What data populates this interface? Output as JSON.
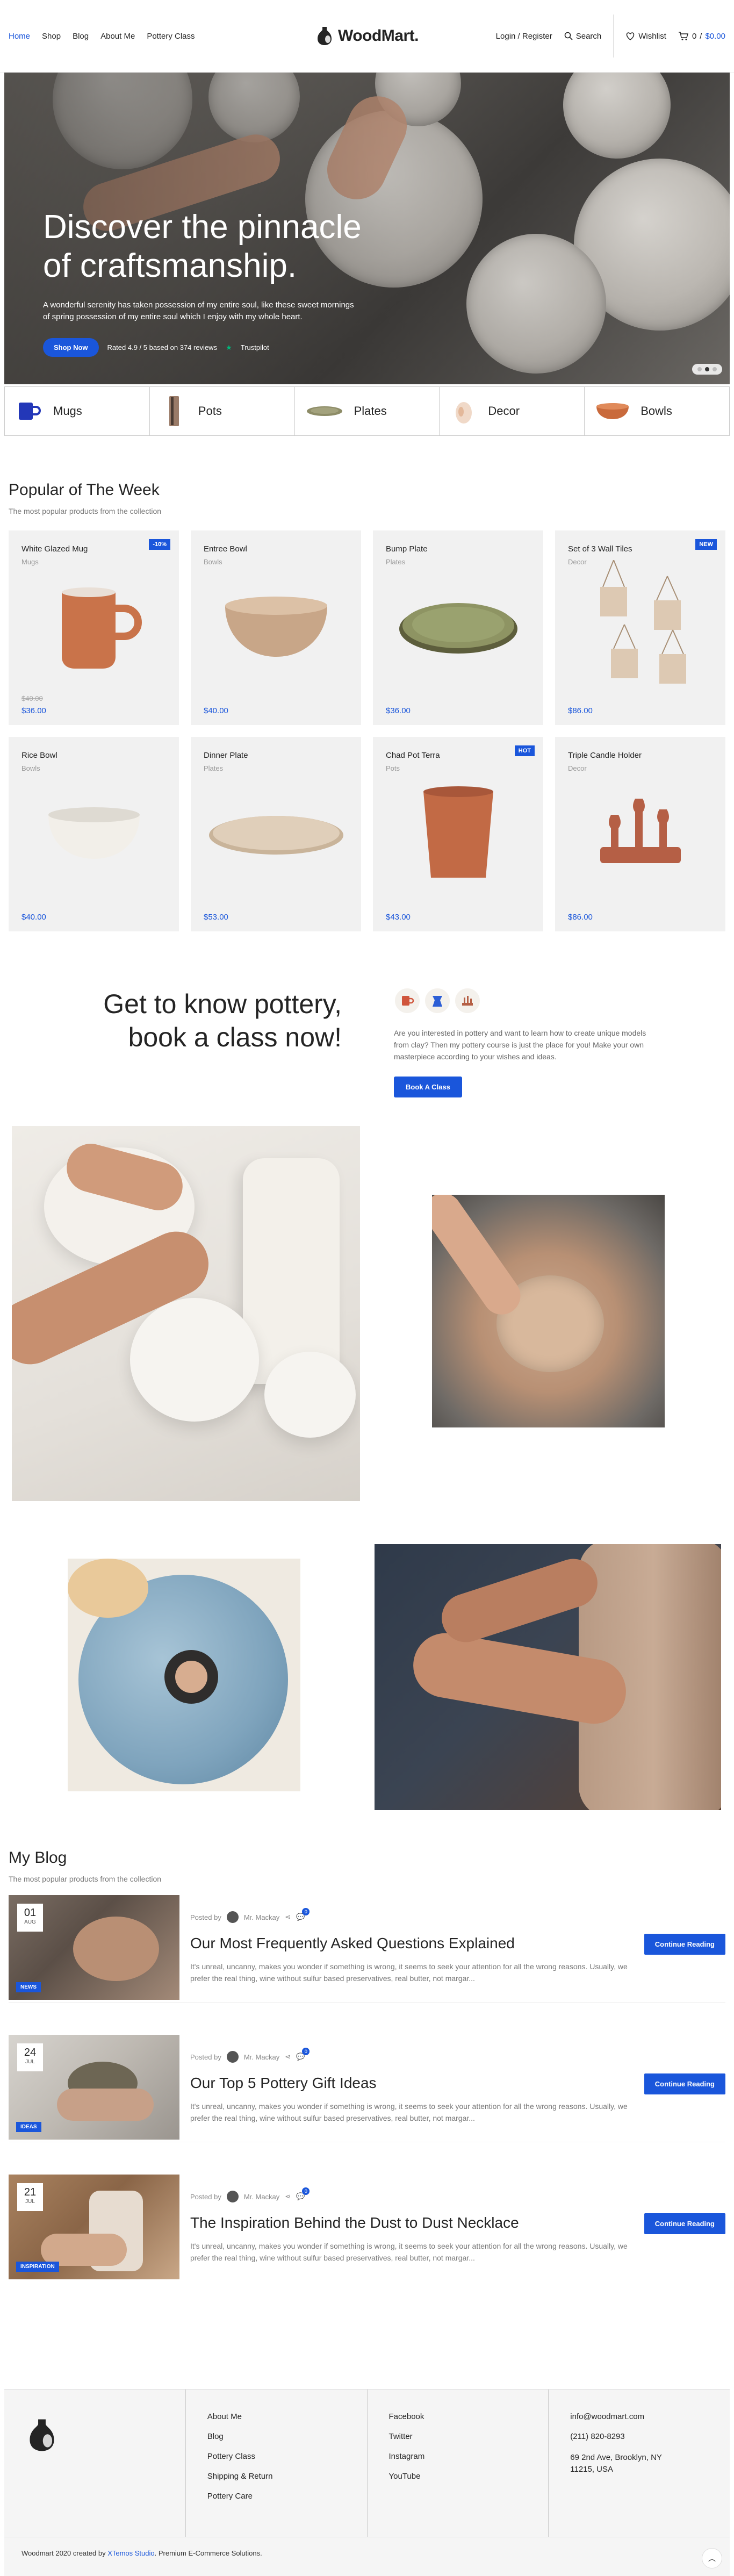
{
  "header": {
    "nav": [
      "Home",
      "Shop",
      "Blog",
      "About Me",
      "Pottery Class"
    ],
    "logo": "WoodMart.",
    "login": "Login / Register",
    "search": "Search",
    "wishlist": "Wishlist",
    "cart_count": "0",
    "cart_price": "$0.00",
    "accent": "#1a56db"
  },
  "hero": {
    "title_line1": "Discover the pinnacle",
    "title_line2": "of craftsmanship.",
    "text": "A wonderful serenity has taken possession of my entire soul, like these sweet mornings of spring possession of my entire soul which I enjoy with my whole heart.",
    "button": "Shop Now",
    "rating": "Rated 4.9 / 5 based on 374 reviews",
    "trustpilot": "Trustpilot"
  },
  "categories": [
    {
      "label": "Mugs",
      "icon": "mug-icon"
    },
    {
      "label": "Pots",
      "icon": "pot-icon"
    },
    {
      "label": "Plates",
      "icon": "plate-icon"
    },
    {
      "label": "Decor",
      "icon": "decor-icon"
    },
    {
      "label": "Bowls",
      "icon": "bowl-icon"
    }
  ],
  "popular": {
    "title": "Popular of The Week",
    "subtitle": "The most popular products from the collection",
    "products": [
      {
        "name": "White Glazed Mug",
        "category": "Mugs",
        "price": "$36.00",
        "old_price": "$40.00",
        "badge": "-10%"
      },
      {
        "name": "Entree Bowl",
        "category": "Bowls",
        "price": "$40.00"
      },
      {
        "name": "Bump Plate",
        "category": "Plates",
        "price": "$36.00"
      },
      {
        "name": "Set of 3 Wall Tiles",
        "category": "Decor",
        "price": "$86.00",
        "badge": "NEW"
      },
      {
        "name": "Rice Bowl",
        "category": "Bowls",
        "price": "$40.00"
      },
      {
        "name": "Dinner Plate",
        "category": "Plates",
        "price": "$53.00"
      },
      {
        "name": "Chad Pot Terra",
        "category": "Pots",
        "price": "$43.00",
        "badge": "HOT"
      },
      {
        "name": "Triple Candle Holder",
        "category": "Decor",
        "price": "$86.00"
      }
    ]
  },
  "klass": {
    "title_line1": "Get to know pottery,",
    "title_line2": "book a class now!",
    "text": "Are you interested in pottery and want to learn how to create unique models from clay? Then my pottery course is just the place for you! Make your own masterpiece according to your wishes and ideas.",
    "button": "Book A Class"
  },
  "blog": {
    "title": "My Blog",
    "subtitle": "The most popular products from the collection",
    "posted_by": "Posted by",
    "author": "Mr. Mackay",
    "read_more": "Continue Reading",
    "posts": [
      {
        "day": "01",
        "month": "AUG",
        "tag": "NEWS",
        "comments": "0",
        "title": "Our Most Frequently Asked Questions Explained",
        "excerpt": "It's unreal, uncanny, makes you wonder if something is wrong, it seems to seek your attention for all the wrong reasons. Usually, we prefer the real thing, wine without sulfur based preservatives, real butter, not margar..."
      },
      {
        "day": "24",
        "month": "JUL",
        "tag": "IDEAS",
        "comments": "0",
        "title": "Our Top 5 Pottery Gift Ideas",
        "excerpt": "It's unreal, uncanny, makes you wonder if something is wrong, it seems to seek your attention for all the wrong reasons. Usually, we prefer the real thing, wine without sulfur based preservatives, real butter, not margar..."
      },
      {
        "day": "21",
        "month": "JUL",
        "tag": "INSPIRATION",
        "comments": "0",
        "title": "The Inspiration Behind the Dust to Dust Necklace",
        "excerpt": "It's unreal, uncanny, makes you wonder if something is wrong, it seems to seek your attention for all the wrong reasons. Usually, we prefer the real thing, wine without sulfur based preservatives, real butter, not margar..."
      }
    ]
  },
  "footer": {
    "links1": [
      "About Me",
      "Blog",
      "Pottery Class",
      "Shipping & Return",
      "Pottery Care"
    ],
    "links2": [
      "Facebook",
      "Twitter",
      "Instagram",
      "YouTube"
    ],
    "email": "info@woodmart.com",
    "phone": "(211) 820-8293",
    "address": "69 2nd Ave, Brooklyn, NY 11215, USA",
    "copy_prefix": "Woodmart 2020 created by ",
    "copy_brand": "XTemos Studio",
    "copy_suffix": ". Premium E-Commerce Solutions."
  }
}
